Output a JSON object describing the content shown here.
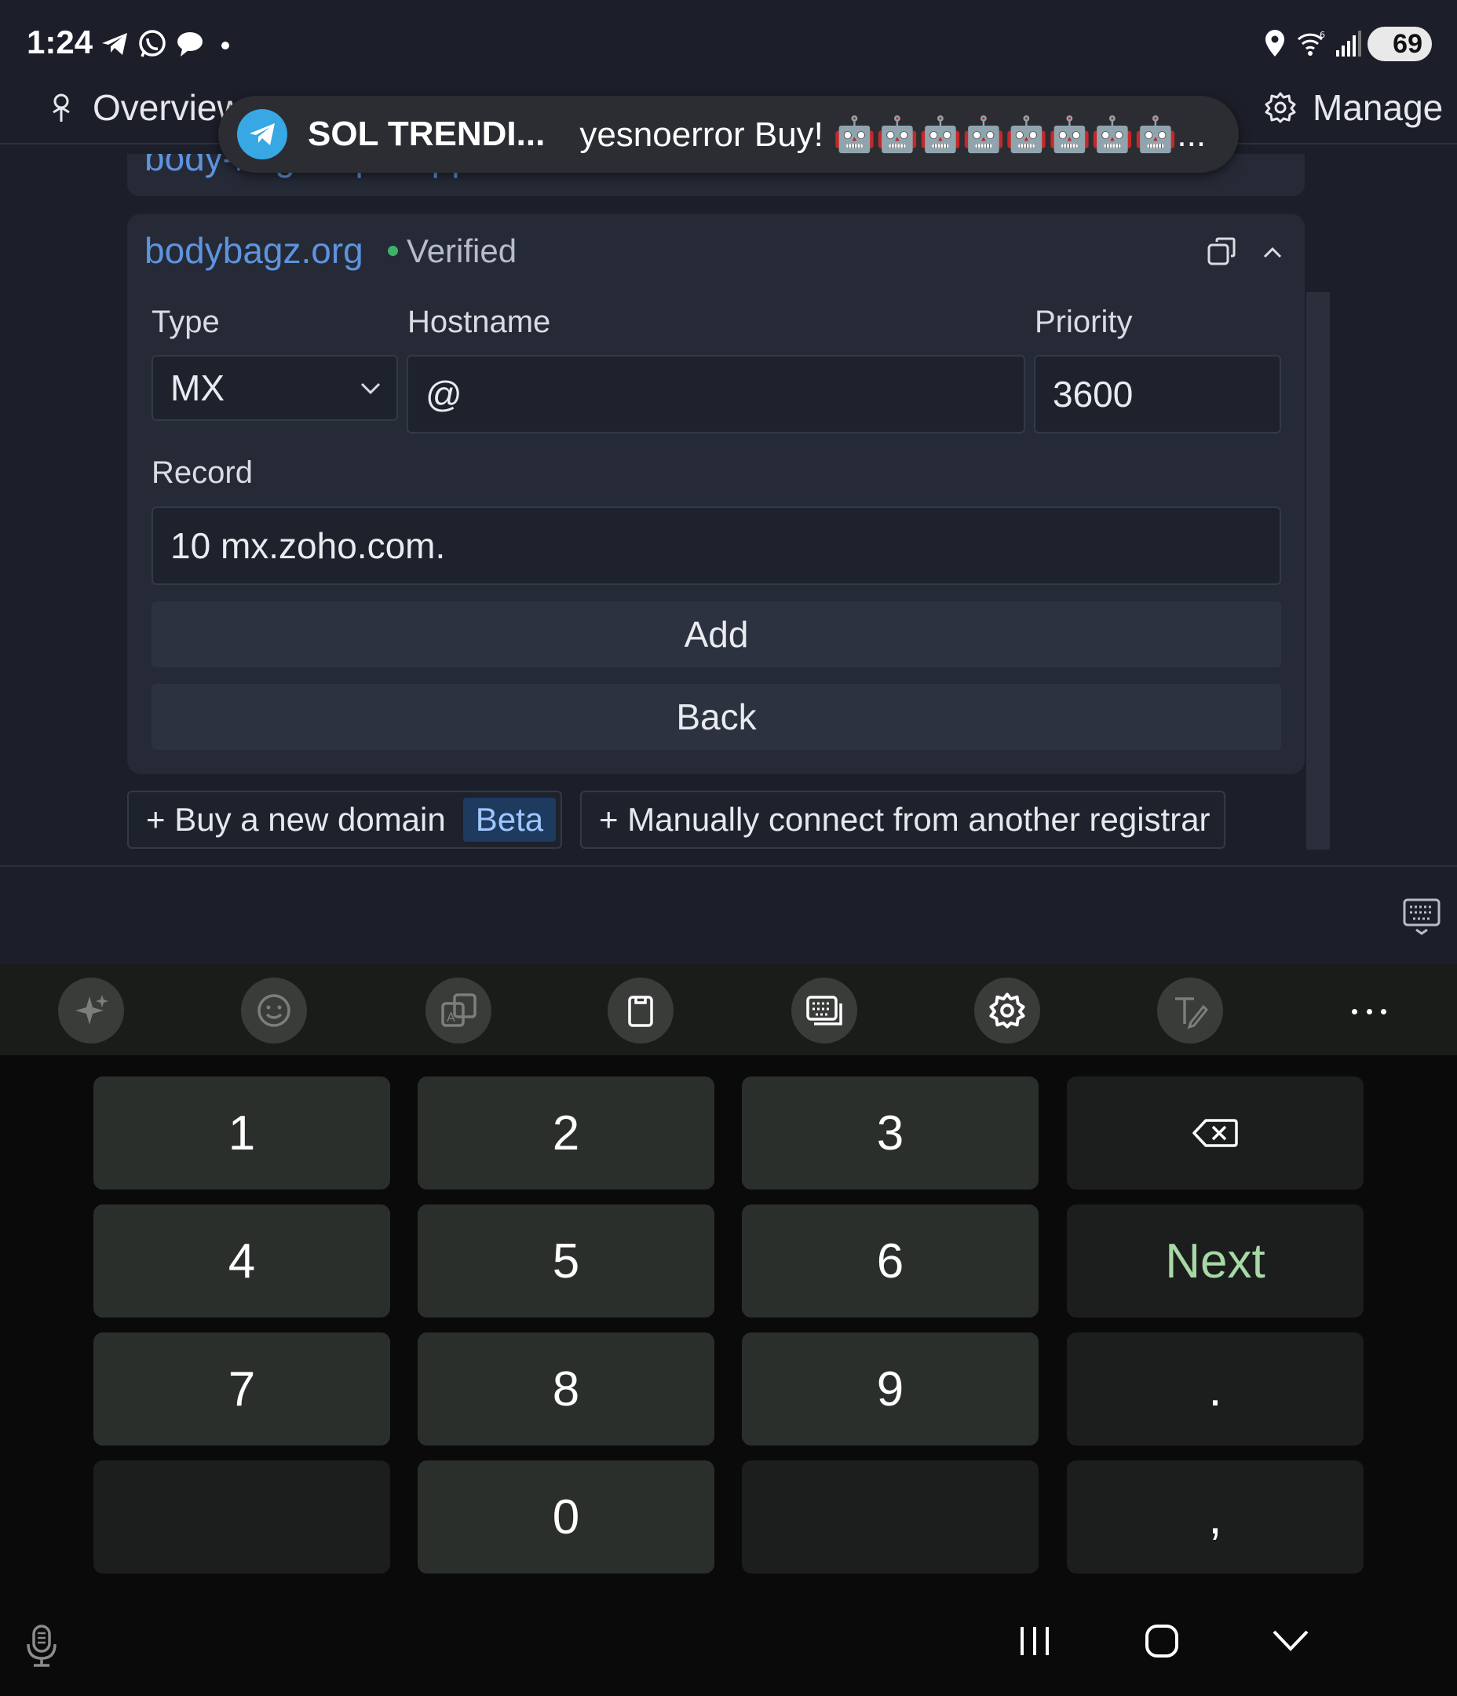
{
  "status_bar": {
    "time": "1:24",
    "battery": "69"
  },
  "nav": {
    "overview_label": "Overview",
    "manage_label": "Manage"
  },
  "toast": {
    "app": "Telegram",
    "title": "SOL TRENDI...",
    "message": "yesnoerror Buy! 🤖🤖🤖🤖🤖🤖🤖🤖..."
  },
  "previous_card": {
    "domain_partial": "body-bagz.replit.app"
  },
  "domain_card": {
    "domain": "bodybagz.org",
    "status": "Verified",
    "type_label": "Type",
    "type_value": "MX",
    "hostname_label": "Hostname",
    "hostname_value": "@",
    "priority_label": "Priority",
    "priority_value": "3600",
    "record_label": "Record",
    "record_value": "10 mx.zoho.com.",
    "add_label": "Add",
    "back_label": "Back"
  },
  "actions": {
    "buy_label": "+ Buy a new domain",
    "beta_badge": "Beta",
    "connect_label": "+ Manually connect from another registrar"
  },
  "keyboard": {
    "toolbar_icons": [
      "ai-sparkle-icon",
      "emoji-icon",
      "translate-icon",
      "clipboard-icon",
      "keyboard-mode-icon",
      "settings-icon",
      "handwriting-icon",
      "more-icon"
    ],
    "keys": {
      "k1": "1",
      "k2": "2",
      "k3": "3",
      "k4": "4",
      "k5": "5",
      "k6": "6",
      "next": "Next",
      "k7": "7",
      "k8": "8",
      "k9": "9",
      "period": ".",
      "k0": "0",
      "comma": ","
    }
  }
}
